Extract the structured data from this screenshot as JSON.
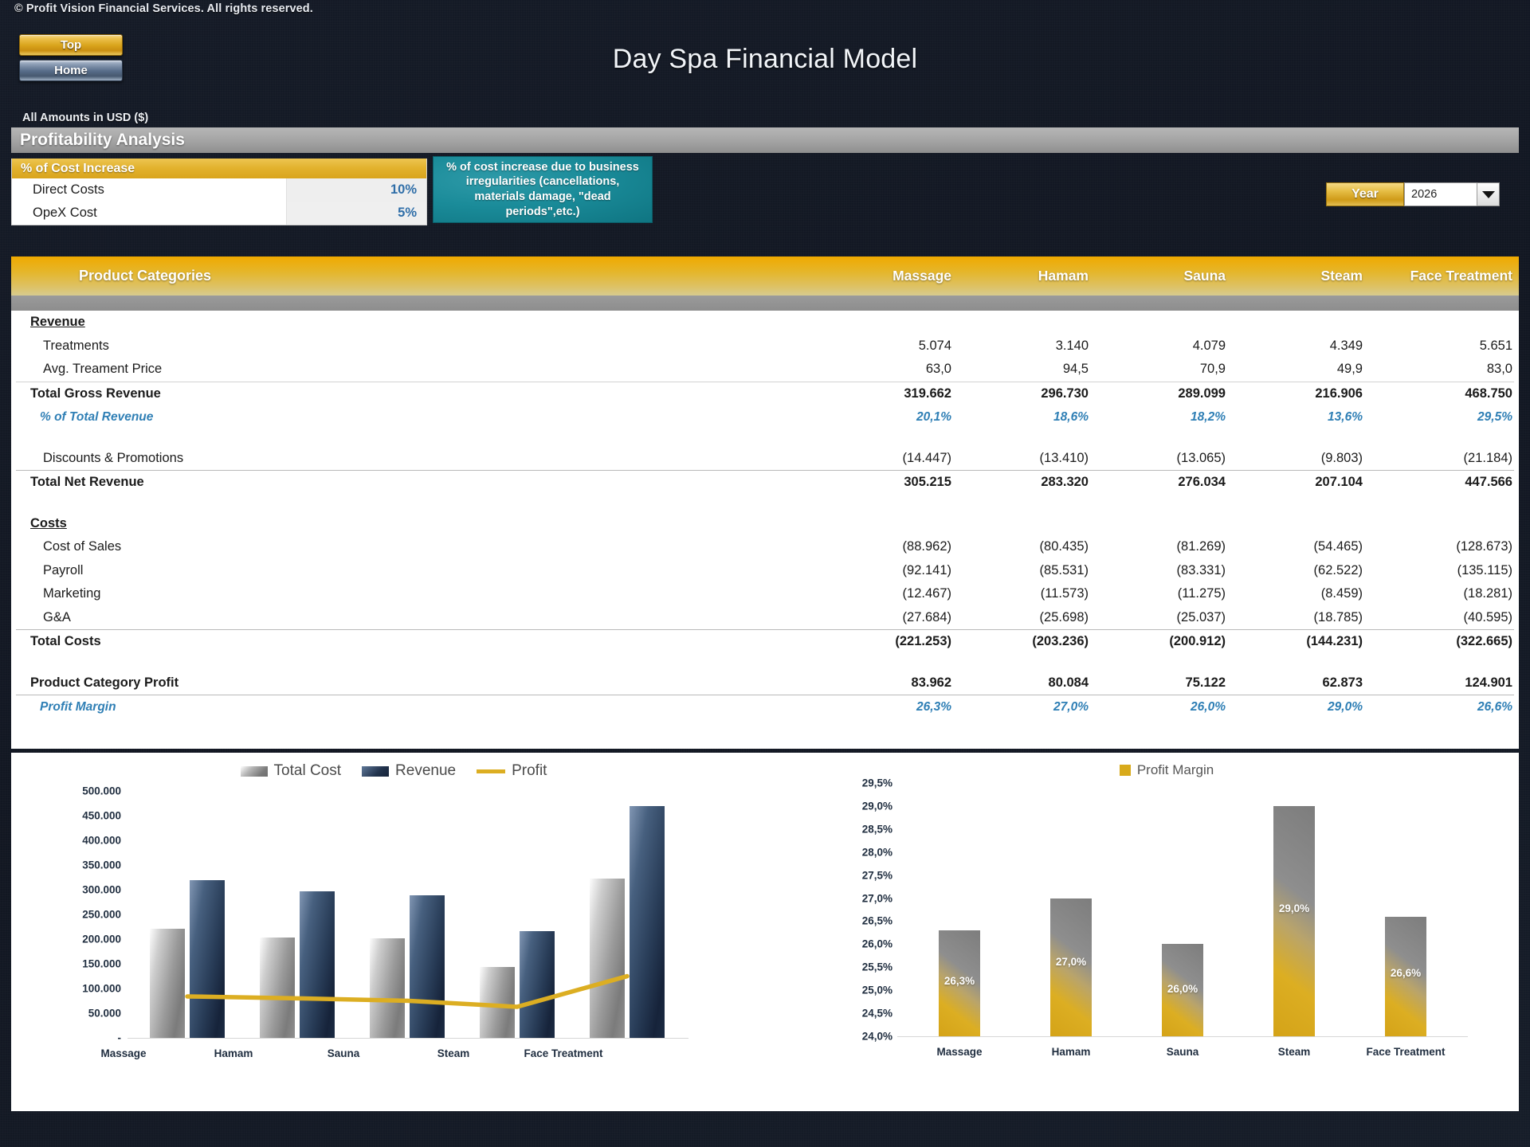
{
  "header": {
    "copyright": "© Profit Vision Financial Services. All rights reserved.",
    "title": "Day Spa Financial Model",
    "amounts_note": "All Amounts in  USD ($)",
    "buttons": {
      "top": "Top",
      "home": "Home"
    }
  },
  "section": {
    "title": "Profitability Analysis"
  },
  "assumptions": {
    "heading": "% of Cost Increase",
    "rows": [
      {
        "label": "Direct Costs",
        "value": "10%"
      },
      {
        "label": "OpeX Cost",
        "value": "5%"
      }
    ],
    "note": "% of cost increase due to business irregularities (cancellations, materials damage, \"dead periods\",etc.)"
  },
  "year_selector": {
    "label": "Year",
    "value": "2026",
    "icon": "chevron-down-icon"
  },
  "table": {
    "row_header": "Product Categories",
    "columns": [
      "Massage",
      "Hamam",
      "Sauna",
      "Steam",
      "Face Treatment"
    ],
    "groups": {
      "revenue_title": "Revenue",
      "costs_title": "Costs"
    },
    "rows": [
      {
        "label": "Treatments",
        "values": [
          "5.074",
          "3.140",
          "4.079",
          "4.349",
          "5.651"
        ]
      },
      {
        "label": "Avg. Treament Price",
        "values": [
          "63,0",
          "94,5",
          "70,9",
          "49,9",
          "83,0"
        ]
      },
      {
        "label": "Total Gross Revenue",
        "values": [
          "319.662",
          "296.730",
          "289.099",
          "216.906",
          "468.750"
        ]
      },
      {
        "label": "% of Total Revenue",
        "values": [
          "20,1%",
          "18,6%",
          "18,2%",
          "13,6%",
          "29,5%"
        ]
      },
      {
        "label": "Discounts & Promotions",
        "values": [
          "(14.447)",
          "(13.410)",
          "(13.065)",
          "(9.803)",
          "(21.184)"
        ]
      },
      {
        "label": "Total Net Revenue",
        "values": [
          "305.215",
          "283.320",
          "276.034",
          "207.104",
          "447.566"
        ]
      },
      {
        "label": "Cost of Sales",
        "values": [
          "(88.962)",
          "(80.435)",
          "(81.269)",
          "(54.465)",
          "(128.673)"
        ]
      },
      {
        "label": "Payroll",
        "values": [
          "(92.141)",
          "(85.531)",
          "(83.331)",
          "(62.522)",
          "(135.115)"
        ]
      },
      {
        "label": "Marketing",
        "values": [
          "(12.467)",
          "(11.573)",
          "(11.275)",
          "(8.459)",
          "(18.281)"
        ]
      },
      {
        "label": "G&A",
        "values": [
          "(27.684)",
          "(25.698)",
          "(25.037)",
          "(18.785)",
          "(40.595)"
        ]
      },
      {
        "label": "Total Costs",
        "values": [
          "(221.253)",
          "(203.236)",
          "(200.912)",
          "(144.231)",
          "(322.665)"
        ]
      },
      {
        "label": "Product Category Profit",
        "values": [
          "83.962",
          "80.084",
          "75.122",
          "62.873",
          "124.901"
        ]
      },
      {
        "label": "Profit Margin",
        "values": [
          "26,3%",
          "27,0%",
          "26,0%",
          "29,0%",
          "26,6%"
        ]
      }
    ]
  },
  "chart_data": [
    {
      "type": "bar",
      "title": "",
      "categories": [
        "Massage",
        "Hamam",
        "Sauna",
        "Steam",
        "Face Treatment"
      ],
      "series": [
        {
          "name": "Total Cost",
          "type": "bar",
          "color": "#8f8f8f",
          "values": [
            221253,
            203236,
            200912,
            144231,
            322665
          ]
        },
        {
          "name": "Revenue",
          "type": "bar",
          "color": "#22334d",
          "values": [
            319662,
            296730,
            289099,
            216906,
            468750
          ]
        },
        {
          "name": "Profit",
          "type": "line",
          "color": "#dcae22",
          "values": [
            83962,
            80084,
            75122,
            62873,
            124901
          ]
        }
      ],
      "ylim": [
        0,
        500000
      ],
      "ytick_labels": [
        "500.000",
        "450.000",
        "400.000",
        "350.000",
        "300.000",
        "250.000",
        "200.000",
        "150.000",
        "100.000",
        "50.000",
        "-"
      ],
      "ytick_values": [
        500000,
        450000,
        400000,
        350000,
        300000,
        250000,
        200000,
        150000,
        100000,
        50000,
        0
      ],
      "xlabel": "",
      "ylabel": "",
      "grid": false,
      "legend_position": "top"
    },
    {
      "type": "bar",
      "title": "",
      "categories": [
        "Massage",
        "Hamam",
        "Sauna",
        "Steam",
        "Face Treatment"
      ],
      "series": [
        {
          "name": "Profit Margin",
          "type": "bar",
          "color": "#d8aa1b",
          "values": [
            26.3,
            27.0,
            26.0,
            29.0,
            26.6
          ],
          "data_labels": [
            "26,3%",
            "27,0%",
            "26,0%",
            "29,0%",
            "26,6%"
          ]
        }
      ],
      "ylim": [
        24.0,
        29.5
      ],
      "ytick_labels": [
        "29,5%",
        "29,0%",
        "28,5%",
        "28,0%",
        "27,5%",
        "27,0%",
        "26,5%",
        "26,0%",
        "25,5%",
        "25,0%",
        "24,5%",
        "24,0%"
      ],
      "ytick_values": [
        29.5,
        29.0,
        28.5,
        28.0,
        27.5,
        27.0,
        26.5,
        26.0,
        25.5,
        25.0,
        24.5,
        24.0
      ],
      "xlabel": "",
      "ylabel": "",
      "grid": false,
      "legend_position": "top"
    }
  ]
}
